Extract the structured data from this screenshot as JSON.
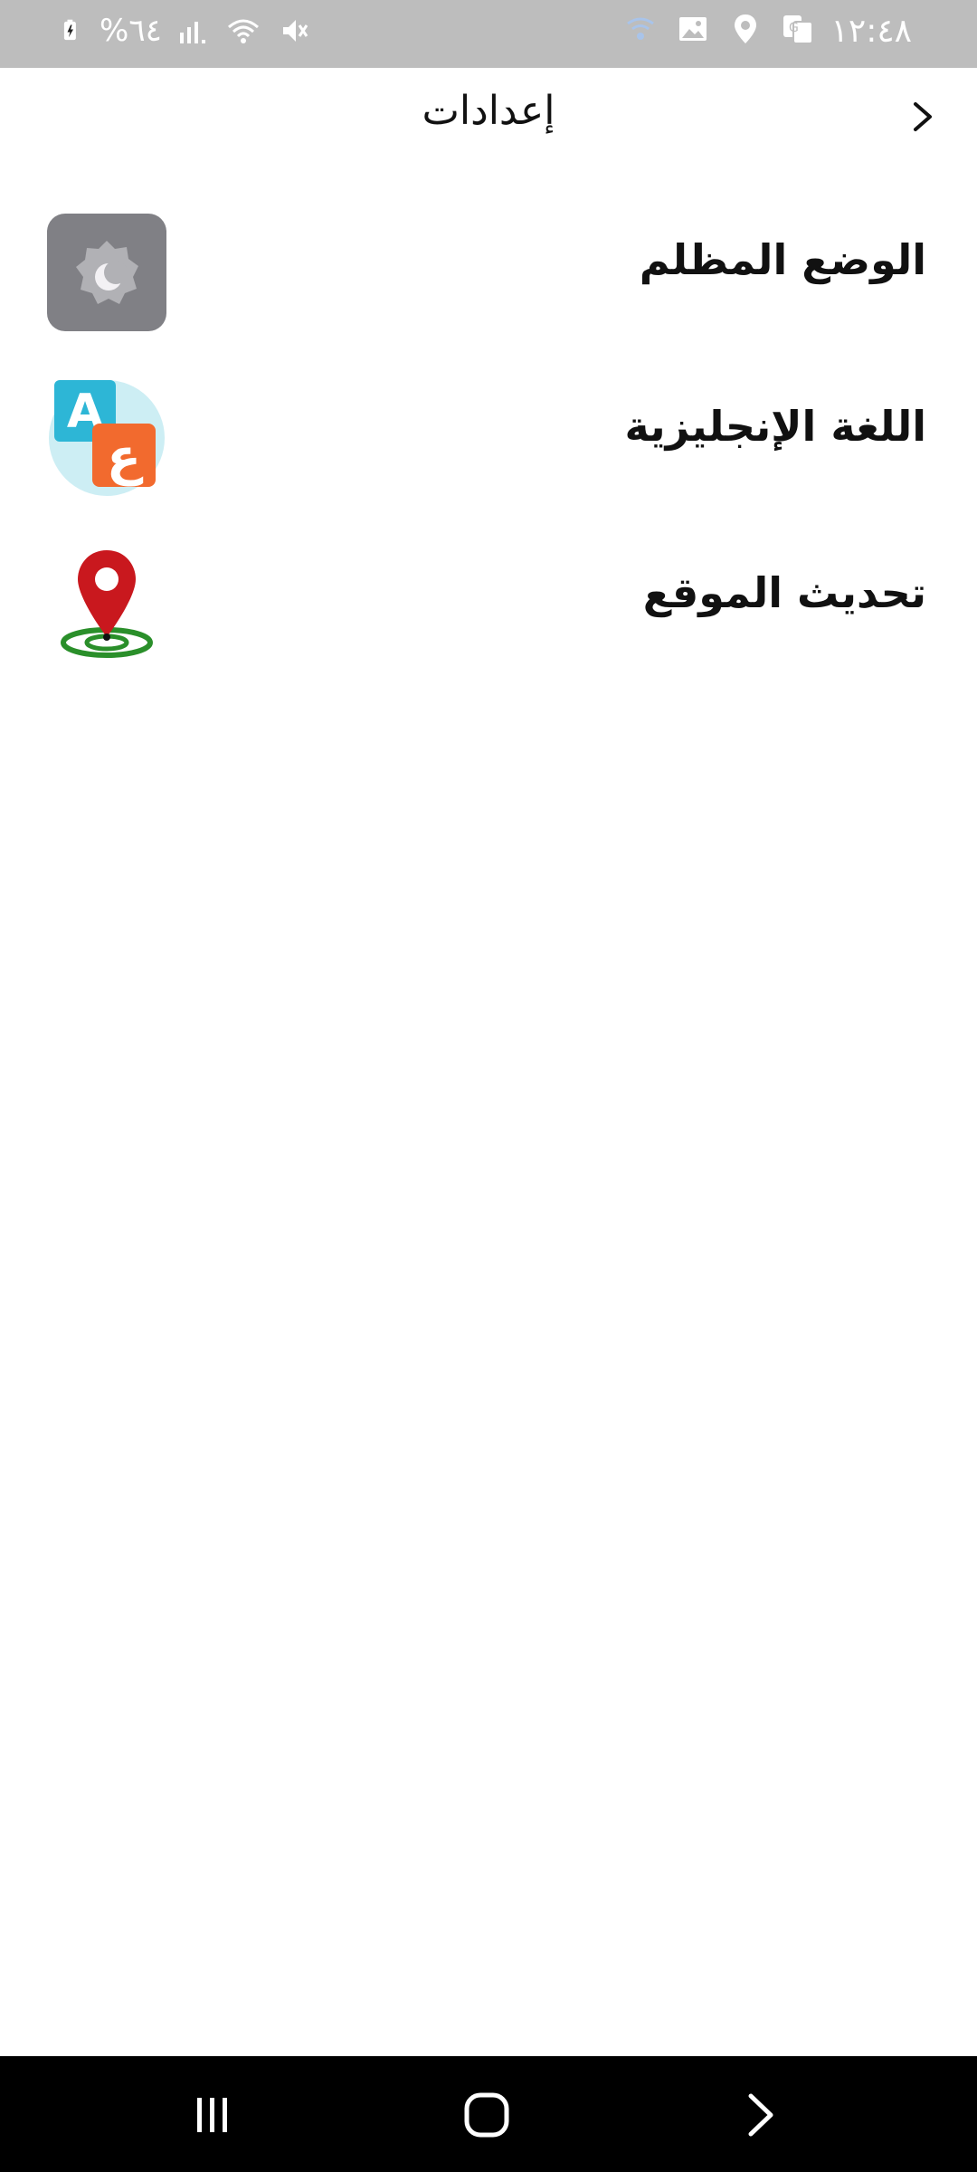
{
  "status_bar": {
    "time": "١٢:٤٨",
    "battery": "%٦٤",
    "icons_right": [
      "wifi-calling-icon",
      "gallery-icon",
      "location-icon",
      "translate-icon"
    ],
    "icons_left": [
      "signal-icon",
      "wifi-icon",
      "mute-icon"
    ]
  },
  "header": {
    "title": "إعدادات",
    "back_icon": "chevron-right-icon"
  },
  "settings": {
    "items": [
      {
        "label": "الوضع المظلم",
        "icon": "dark-mode-icon"
      },
      {
        "label": "اللغة الإنجليزية",
        "icon": "language-icon"
      },
      {
        "label": "تحديث الموقع",
        "icon": "location-pin-icon"
      }
    ]
  },
  "nav_bar": {
    "buttons": [
      "recent-apps-icon",
      "home-icon",
      "back-icon"
    ]
  },
  "colors": {
    "status_bar_bg": "#bdbdbd",
    "dark_mode_tile": "#808085",
    "language_circle": "#cdeef4",
    "language_a": "#2db6d6",
    "language_ain": "#f26a2e",
    "pin_red": "#c9181e",
    "pin_ring": "#2a8f2a"
  }
}
